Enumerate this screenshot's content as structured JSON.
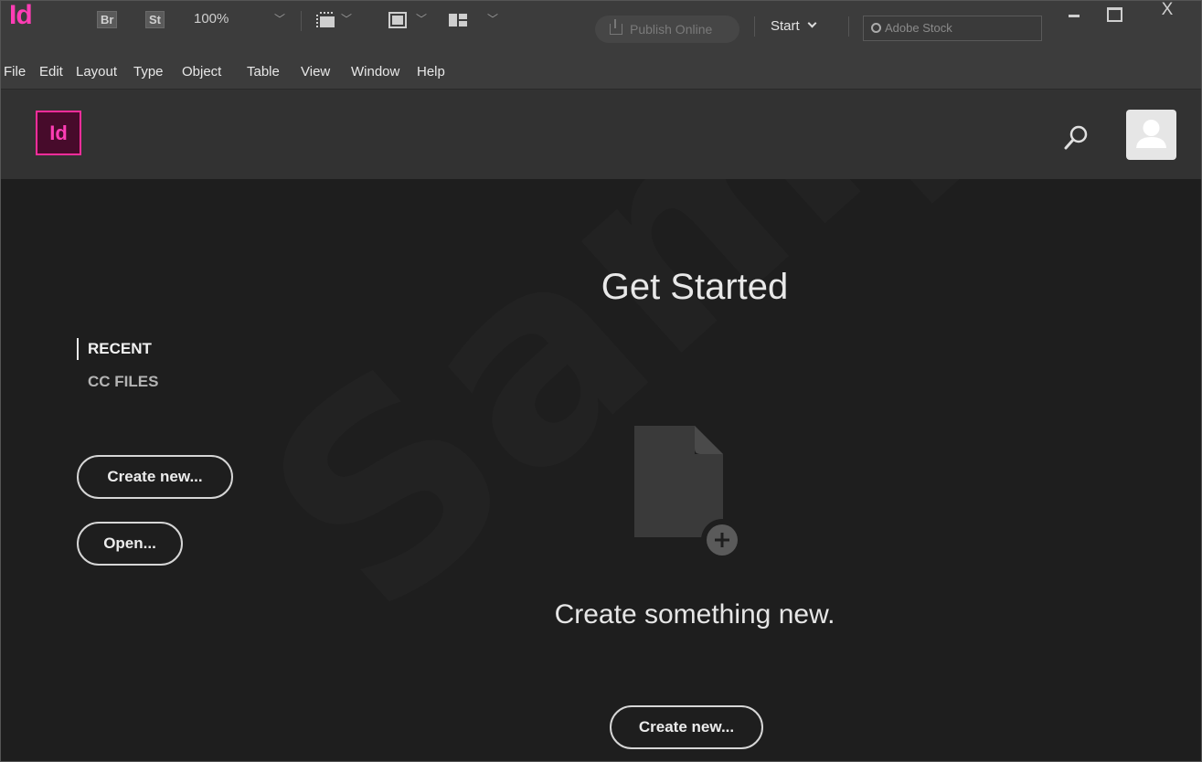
{
  "app": {
    "logo_text": "Id",
    "bridge_label": "Br",
    "stock_label": "St",
    "zoom": "100%",
    "publish_label": "Publish Online",
    "workspace_label": "Start",
    "search_placeholder": "Adobe Stock",
    "close_glyph": "X"
  },
  "menu": {
    "items": [
      "File",
      "Edit",
      "Layout",
      "Type",
      "Object",
      "Table",
      "View",
      "Window",
      "Help"
    ]
  },
  "header": {
    "logo_text": "Id"
  },
  "main": {
    "title": "Get Started",
    "nav_recent": "RECENT",
    "nav_cc_files": "CC FILES",
    "create_new_label": "Create new...",
    "open_label": "Open...",
    "tagline": "Create something new.",
    "create_new_main_label": "Create new...",
    "watermark": "Sample"
  },
  "colors": {
    "accent": "#ff3db5",
    "background": "#1e1e1e",
    "toolbar": "#3c3c3c",
    "header": "#323232"
  }
}
